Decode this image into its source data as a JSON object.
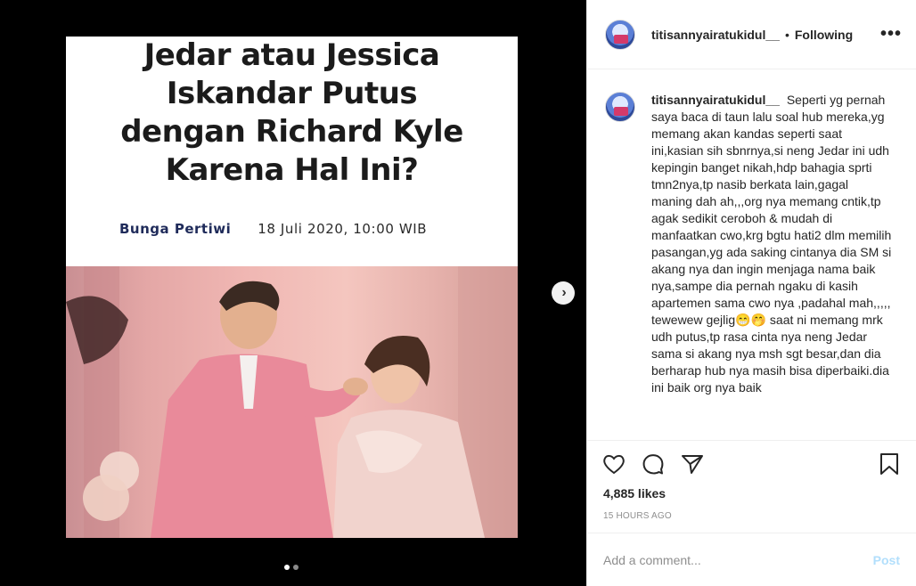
{
  "post": {
    "headline": "Jedar atau Jessica Iskandar Putus dengan Richard Kyle Karena Hal Ini?",
    "author": "Bunga Pertiwi",
    "date": "18 Juli 2020, 10:00 WIB",
    "photo_icon": "couple-photo"
  },
  "carousel": {
    "next_icon": "chevron-right-icon",
    "next_glyph": "›",
    "slide_count": 2,
    "current_slide": 1
  },
  "header": {
    "username": "titisannyairatukidul__",
    "separator": "•",
    "follow_status": "Following",
    "more_glyph": "•••"
  },
  "caption": {
    "username": "titisannyairatukidul__",
    "text": "Seperti yg pernah saya baca di taun lalu soal hub mereka,yg memang akan kandas seperti saat ini,kasian sih sbnrnya,si neng Jedar ini udh kepingin banget nikah,hdp bahagia sprti tmn2nya,tp nasib berkata lain,gagal maning dah ah,,,org nya memang cntik,tp agak sedikit ceroboh & mudah di manfaatkan cwo,krg bgtu hati2 dlm memilih pasangan,yg ada saking cintanya dia SM si akang nya dan ingin menjaga nama baik nya,sampe dia pernah ngaku di kasih apartemen sama cwo nya ,padahal mah,,,,, tewewew gejlig😁🤭 saat ni memang mrk udh putus,tp rasa cinta nya neng Jedar sama si akang nya msh sgt besar,dan dia berharap hub nya masih bisa diperbaiki.dia ini baik org nya baik"
  },
  "actions": {
    "like_icon": "heart-icon",
    "comment_icon": "comment-icon",
    "share_icon": "share-icon",
    "save_icon": "bookmark-icon"
  },
  "likes": "4,885 likes",
  "time_ago": "15 HOURS AGO",
  "comment": {
    "placeholder": "Add a comment...",
    "post_label": "Post"
  },
  "colors": {
    "link_disabled": "#b2dffc",
    "text": "#262626",
    "muted": "#8e8e8e"
  }
}
